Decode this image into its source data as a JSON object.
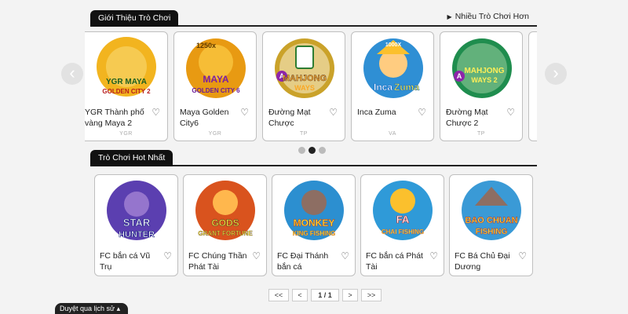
{
  "intro": {
    "tab": "Giới Thiệu Trò Chơi",
    "more": "Nhiều Trò Chơi Hơn"
  },
  "carousel": [
    {
      "name": "YGR Thành phố vàng Maya 2",
      "provider": "YGR",
      "art_line1": "YGR MAYA",
      "art_line2": "GOLDEN CITY 2",
      "badge": "",
      "bg": "#f2b41f"
    },
    {
      "name": "Maya Golden City6",
      "provider": "YGR",
      "art_line1": "MAYA",
      "art_line2": "GOLDEN CITY 6",
      "badge": "1250x",
      "bg": "#e89a12"
    },
    {
      "name": "Đường Mạt Chược",
      "provider": "TP",
      "art_line1": "MAHJONG",
      "art_line2": "WAYS",
      "badge": "A",
      "bg": "#caa22a"
    },
    {
      "name": "Inca Zuma",
      "provider": "VA",
      "art_line1": "Inca",
      "art_line2": "Zuma",
      "badge": "1000X",
      "bg": "#2f8fd4"
    },
    {
      "name": "Đường Mạt Chược 2",
      "provider": "TP",
      "art_line1": "MAHJONG",
      "art_line2": "WAYS 2",
      "badge": "A",
      "bg": "#1f8d4e"
    }
  ],
  "dots": [
    false,
    true,
    false
  ],
  "hot": {
    "tab": "Trò Chơi Hot Nhất"
  },
  "hot_games": [
    {
      "name": "FC bắn cá Vũ Trụ",
      "art_line1": "STAR",
      "art_line2": "HUNTER",
      "bg": "#5b3fb0"
    },
    {
      "name": "FC Chúng Thần Phát Tài",
      "art_line1": "GODS",
      "art_line2": "GRANT FORTUNE",
      "bg": "#d9531e"
    },
    {
      "name": "FC Đại Thánh bắn cá",
      "art_line1": "MONKEY",
      "art_line2": "KING FISHING",
      "bg": "#2c8fd0"
    },
    {
      "name": "FC bắn cá Phát Tài",
      "art_line1": "FA",
      "art_line2": "CHAI FISHING",
      "bg": "#2f9ad8"
    },
    {
      "name": "FC Bá Chủ Đại Dương",
      "art_line1": "BAO CHUAN",
      "art_line2": "FISHING",
      "bg": "#3a9ad6"
    }
  ],
  "pager": {
    "first": "<<",
    "prev": "<",
    "current": "1 / 1",
    "next": ">",
    "last": ">>"
  },
  "history": "Duyệt qua lịch sử"
}
